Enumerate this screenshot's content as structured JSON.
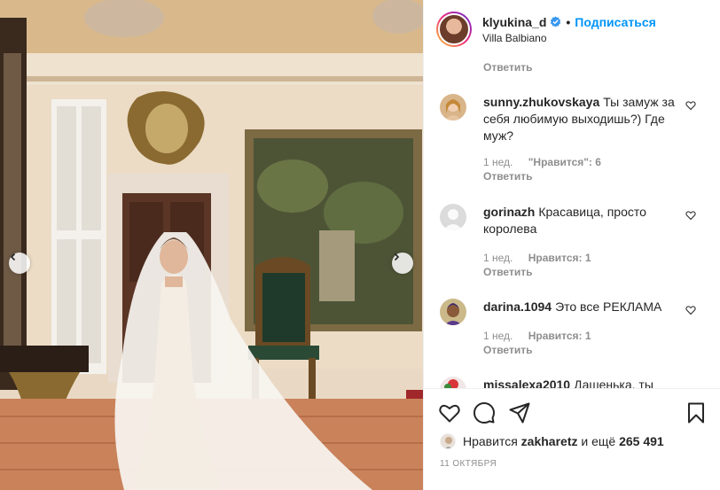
{
  "header": {
    "username": "klyukina_d",
    "dot": "•",
    "follow_label": "Подписаться",
    "location": "Villa Balbiano"
  },
  "comments": {
    "top_reply_label": "Ответить",
    "items": [
      {
        "user": "sunny.zhukovskaya",
        "text": "Ты замуж за себя любимую выходишь?) Где муж?",
        "time": "1 нед.",
        "likes": "\"Нравится\": 6",
        "reply": "Ответить"
      },
      {
        "user": "gorinazh",
        "text": "Красавица, просто королева",
        "time": "1 нед.",
        "likes": "Нравится: 1",
        "reply": "Ответить"
      },
      {
        "user": "darina.1094",
        "text": "Это все РЕКЛАМА",
        "time": "1 нед.",
        "likes": "Нравится: 1",
        "reply": "Ответить"
      },
      {
        "user": "missalexa2010",
        "text": "Дашенька, ты"
      }
    ]
  },
  "actions": {
    "likes_prefix": "Нравится",
    "likes_user": "zakharetz",
    "likes_middle": "и ещё",
    "likes_count": "265 491",
    "date": "11 ОКТЯБРЯ"
  },
  "icons": {
    "like": "heart-icon",
    "comment": "comment-icon",
    "share": "share-icon",
    "save": "bookmark-icon",
    "verified": "verified-badge-icon",
    "prev": "chevron-left-icon",
    "next": "chevron-right-icon"
  },
  "colors": {
    "accent": "#0095f6",
    "text": "#262626",
    "muted": "#8e8e8e",
    "divider": "#efefef"
  }
}
